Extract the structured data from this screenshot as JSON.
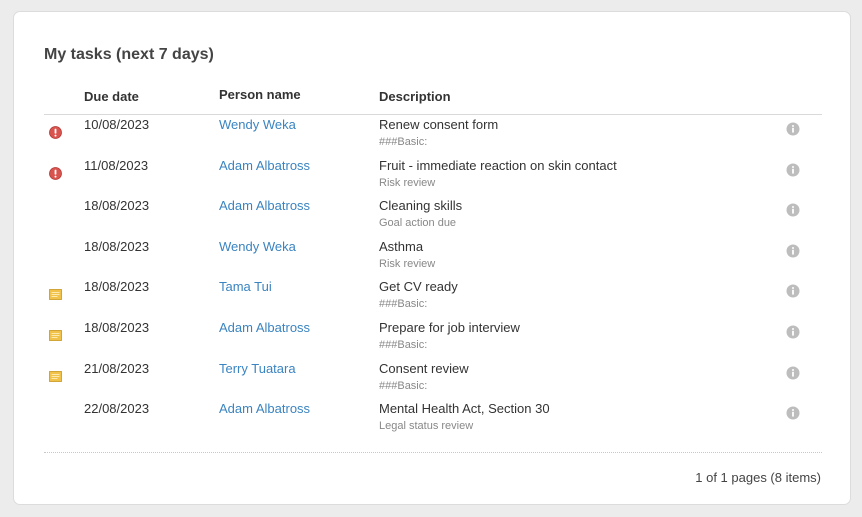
{
  "panel": {
    "title": "My tasks (next 7 days)"
  },
  "columns": {
    "due_date": "Due date",
    "person_name": "Person name",
    "description": "Description"
  },
  "tasks": [
    {
      "status": "overdue",
      "due_date": "10/08/2023",
      "person": "Wendy Weka",
      "description": "Renew consent form",
      "subtitle": "###Basic:"
    },
    {
      "status": "overdue",
      "due_date": "11/08/2023",
      "person": "Adam Albatross",
      "description": "Fruit - immediate reaction on skin contact",
      "subtitle": "Risk review"
    },
    {
      "status": "none",
      "due_date": "18/08/2023",
      "person": "Adam Albatross",
      "description": "Cleaning skills",
      "subtitle": "Goal action due"
    },
    {
      "status": "none",
      "due_date": "18/08/2023",
      "person": "Wendy Weka",
      "description": "Asthma",
      "subtitle": "Risk review"
    },
    {
      "status": "note",
      "due_date": "18/08/2023",
      "person": "Tama Tui",
      "description": "Get CV ready",
      "subtitle": "###Basic:"
    },
    {
      "status": "note",
      "due_date": "18/08/2023",
      "person": "Adam Albatross",
      "description": "Prepare for job interview",
      "subtitle": "###Basic:"
    },
    {
      "status": "note",
      "due_date": "21/08/2023",
      "person": "Terry Tuatara",
      "description": "Consent review",
      "subtitle": "###Basic:"
    },
    {
      "status": "none",
      "due_date": "22/08/2023",
      "person": "Adam Albatross",
      "description": "Mental Health Act, Section 30",
      "subtitle": "Legal status review"
    }
  ],
  "icons": {
    "overdue": "alert-circle-icon",
    "note": "note-icon",
    "info": "info-icon"
  },
  "colors": {
    "link": "#3a84c1",
    "overdue": "#d9534f",
    "note": "#f0c24a",
    "info": "#bdbdbd"
  },
  "pager": {
    "summary": "1 of 1 pages (8 items)"
  }
}
